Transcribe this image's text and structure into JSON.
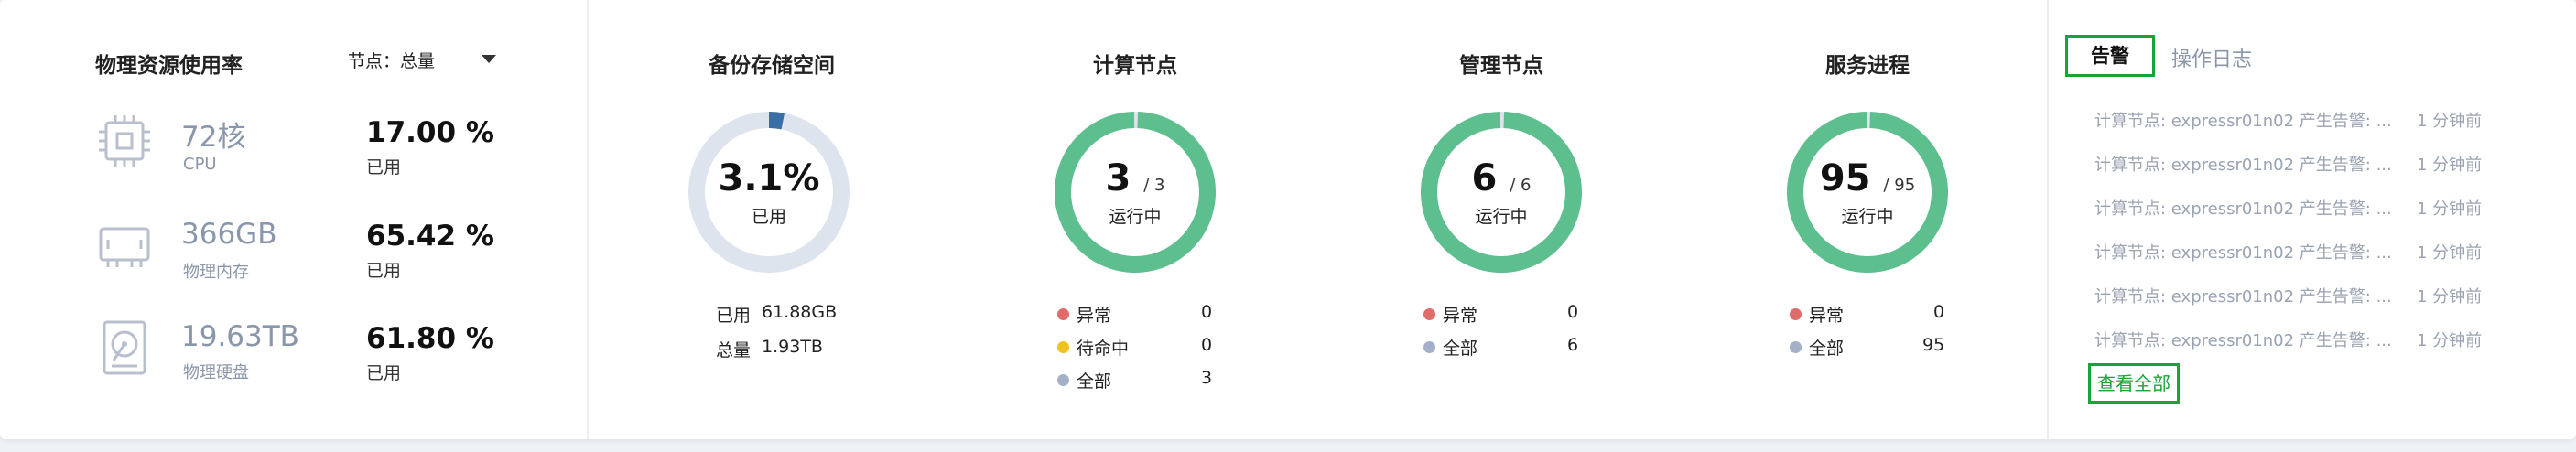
{
  "resources": {
    "title": "物理资源使用率",
    "node_filter_label": "节点：总量",
    "items": [
      {
        "icon": "cpu-icon",
        "value": "72核",
        "label": "CPU",
        "percent": "17.00 %",
        "percent_label": "已用"
      },
      {
        "icon": "memory-icon",
        "value": "366GB",
        "label": "物理内存",
        "percent": "65.42 %",
        "percent_label": "已用"
      },
      {
        "icon": "disk-icon",
        "value": "19.63TB",
        "label": "物理硬盘",
        "percent": "61.80 %",
        "percent_label": "已用"
      }
    ]
  },
  "backup": {
    "title": "备份存储空间",
    "percent": "3.1%",
    "percent_value": 3.1,
    "sub": "已用",
    "used_label": "已用",
    "used_value": "61.88GB",
    "total_label": "总量",
    "total_value": "1.93TB"
  },
  "compute": {
    "title": "计算节点",
    "num": "3",
    "den": "/ 3",
    "fraction": 1.0,
    "sub": "运行中",
    "legend": [
      {
        "label": "异常",
        "value": "0",
        "color": "#e06b6b"
      },
      {
        "label": "待命中",
        "value": "0",
        "color": "#f0c21a"
      },
      {
        "label": "全部",
        "value": "3",
        "color": "#a4b0c8"
      }
    ]
  },
  "manage": {
    "title": "管理节点",
    "num": "6",
    "den": "/ 6",
    "fraction": 1.0,
    "sub": "运行中",
    "legend": [
      {
        "label": "异常",
        "value": "0",
        "color": "#e06b6b"
      },
      {
        "label": "全部",
        "value": "6",
        "color": "#a4b0c8"
      }
    ]
  },
  "service": {
    "title": "服务进程",
    "num": "95",
    "den": "/ 95",
    "fraction": 1.0,
    "sub": "运行中",
    "legend": [
      {
        "label": "异常",
        "value": "0",
        "color": "#e06b6b"
      },
      {
        "label": "全部",
        "value": "95",
        "color": "#a4b0c8"
      }
    ]
  },
  "colors": {
    "ring_green": "#5cbf8d",
    "ring_track": "#dde4ee",
    "ring_blue": "#3a6ea5",
    "accent_green": "#1aa336"
  },
  "alerts": {
    "tab_active": "告警",
    "tab_other": "操作日志",
    "items": [
      {
        "text": "计算节点: expressr01n02 产生告警: ...",
        "time": "1 分钟前"
      },
      {
        "text": "计算节点: expressr01n02 产生告警: ...",
        "time": "1 分钟前"
      },
      {
        "text": "计算节点: expressr01n02 产生告警: ...",
        "time": "1 分钟前"
      },
      {
        "text": "计算节点: expressr01n02 产生告警: ...",
        "time": "1 分钟前"
      },
      {
        "text": "计算节点: expressr01n02 产生告警: ...",
        "time": "1 分钟前"
      },
      {
        "text": "计算节点: expressr01n02 产生告警: ...",
        "time": "1 分钟前"
      }
    ],
    "view_all": "查看全部"
  }
}
